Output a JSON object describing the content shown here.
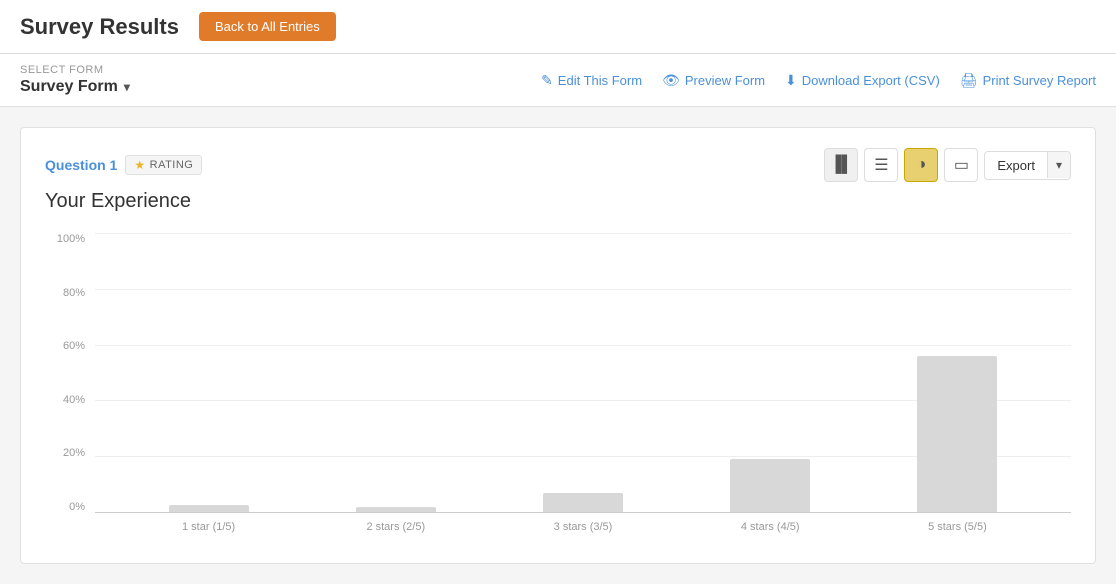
{
  "topbar": {
    "title": "Survey Results",
    "back_button_label": "Back to All Entries"
  },
  "toolbar": {
    "select_form_label": "SELECT FORM",
    "form_name": "Survey Form",
    "edit_link": "Edit This Form",
    "preview_link": "Preview Form",
    "download_link": "Download Export (CSV)",
    "print_link": "Print Survey Report",
    "edit_icon": "✎",
    "preview_icon": "👁",
    "download_icon": "⬇",
    "print_icon": "🖨"
  },
  "question": {
    "number_label": "Question 1",
    "type_label": "RATING",
    "title": "Your Experience",
    "export_label": "Export",
    "chart_icons": {
      "bar_icon": "📊",
      "list_icon": "☰",
      "pie_icon": "◑",
      "image_icon": "🖼"
    }
  },
  "chart": {
    "y_labels": [
      "100%",
      "80%",
      "60%",
      "40%",
      "20%",
      "0%"
    ],
    "bars": [
      {
        "label": "1 star (1/5)",
        "value": 3,
        "height_pct": 3
      },
      {
        "label": "2 stars (2/5)",
        "value": 2,
        "height_pct": 2
      },
      {
        "label": "3 stars (3/5)",
        "value": 8,
        "height_pct": 8
      },
      {
        "label": "4 stars (4/5)",
        "value": 22,
        "height_pct": 22
      },
      {
        "label": "5 stars (5/5)",
        "value": 65,
        "height_pct": 65
      }
    ]
  }
}
